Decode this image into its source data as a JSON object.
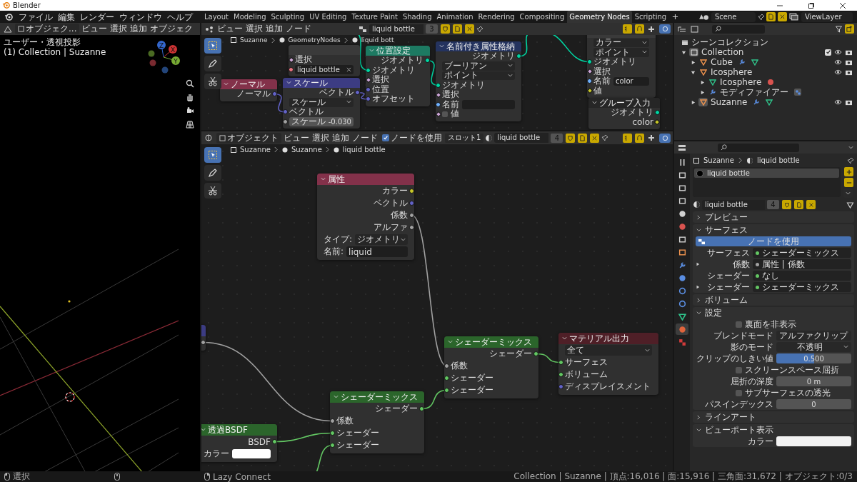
{
  "window": {
    "title": "Blender"
  },
  "menu": [
    "ファイル",
    "編集",
    "レンダー",
    "ウィンドウ",
    "ヘルプ"
  ],
  "workspaces": [
    {
      "label": "Layout",
      "selected": false
    },
    {
      "label": "Modeling",
      "selected": false
    },
    {
      "label": "Sculpting",
      "selected": false
    },
    {
      "label": "UV Editing",
      "selected": false
    },
    {
      "label": "Texture Paint",
      "selected": false
    },
    {
      "label": "Shading",
      "selected": false
    },
    {
      "label": "Animation",
      "selected": false
    },
    {
      "label": "Rendering",
      "selected": false
    },
    {
      "label": "Compositing",
      "selected": false
    },
    {
      "label": "Geometry Nodes",
      "selected": true
    },
    {
      "label": "Scripting",
      "selected": false
    }
  ],
  "scene": "Scene",
  "view_layer": "ViewLayer",
  "viewport": {
    "mode": "オブジェク...",
    "menus": [
      "ビュー",
      "選択",
      "追加",
      "オブジェク"
    ],
    "view_name": "ユーザー・透視投影",
    "collection_label": "(1) Collection | Suzanne",
    "axes": [
      "X",
      "Y",
      "Z"
    ]
  },
  "geometry_editor": {
    "menus": [
      "ビュー",
      "選択",
      "追加",
      "ノード"
    ],
    "datablock": "liquid bottle",
    "users": "3",
    "breadcrumb": [
      "Suzanne",
      "GeometryNodes",
      "liquid bott"
    ],
    "nodes": [
      {
        "kind": "plain",
        "rows": [
          {
            "kind": "input",
            "label": "選択",
            "socket": {
              "kind": "bool"
            }
          },
          {
            "kind": "field",
            "value": "liquid bottle",
            "socket": {
              "kind": "material"
            },
            "clearable": true
          }
        ]
      },
      {
        "title": "ノーマル",
        "kind": "input",
        "rows": [
          {
            "kind": "output",
            "label": "ノーマル",
            "socket": {
              "kind": "vector"
            }
          }
        ]
      },
      {
        "title": "スケール",
        "kind": "vector",
        "rows": [
          {
            "kind": "output",
            "label": "ベクトル",
            "socket": {
              "kind": "vector"
            }
          },
          {
            "kind": "dropdown",
            "value": "スケール"
          },
          {
            "kind": "input",
            "label": "ベクトル",
            "socket": {
              "kind": "vector"
            }
          },
          {
            "kind": "number",
            "label": "スケール",
            "value": "-0.030",
            "socket": {
              "kind": "float"
            }
          }
        ]
      },
      {
        "title": "位置設定",
        "kind": "geometry",
        "rows": [
          {
            "kind": "output",
            "label": "ジオメトリ",
            "socket": {
              "kind": "geometry"
            }
          },
          {
            "kind": "input",
            "label": "ジオメトリ",
            "socket": {
              "kind": "geometry"
            }
          },
          {
            "kind": "input",
            "label": "選択",
            "socket": {
              "kind": "bool"
            }
          },
          {
            "kind": "input",
            "label": "位置",
            "socket": {
              "kind": "vector"
            }
          },
          {
            "kind": "input",
            "label": "オフセット",
            "socket": {
              "kind": "vector"
            }
          }
        ]
      },
      {
        "title": "名前付き属性格納",
        "kind": "attribute",
        "rows": [
          {
            "kind": "output",
            "label": "ジオメトリ",
            "socket": {
              "kind": "geometry"
            }
          },
          {
            "kind": "dropdown",
            "value": "ブーリアン"
          },
          {
            "kind": "dropdown",
            "value": "ポイント"
          },
          {
            "kind": "input",
            "label": "ジオメトリ",
            "socket": {
              "kind": "geometry"
            }
          },
          {
            "kind": "input",
            "label": "選択",
            "socket": {
              "kind": "bool"
            }
          },
          {
            "kind": "field",
            "label": "名前",
            "socket": {
              "kind": "string"
            }
          },
          {
            "kind": "checkbox",
            "label": "値",
            "checked": false,
            "socket": {
              "kind": "bool"
            }
          }
        ]
      },
      {
        "kind": "plain",
        "rows": [
          {
            "kind": "dropdown",
            "value": "カラー"
          },
          {
            "kind": "dropdown",
            "value": "ポイント"
          },
          {
            "kind": "input",
            "label": "ジオメトリ",
            "socket": {
              "kind": "geometry"
            }
          },
          {
            "kind": "input",
            "label": "選択",
            "socket": {
              "kind": "bool"
            }
          },
          {
            "kind": "field",
            "label": "名前",
            "value": "color",
            "socket": {
              "kind": "string"
            }
          },
          {
            "kind": "input",
            "label": "値",
            "socket": {
              "kind": "color_field"
            }
          }
        ]
      },
      {
        "title": "グループ入力",
        "kind": "group",
        "rows": [
          {
            "kind": "output",
            "label": "ジオメトリ",
            "socket": {
              "kind": "geometry"
            }
          },
          {
            "kind": "output",
            "label": "color",
            "socket": {
              "kind": "color_field"
            }
          }
        ]
      }
    ]
  },
  "shader_editor": {
    "mode": "オブジェクト",
    "menus": [
      "ビュー",
      "選択",
      "追加",
      "ノード"
    ],
    "use_nodes": {
      "label": "ノードを使用",
      "checked": true
    },
    "slot": "スロット1",
    "material": "liquid bottle",
    "users": "4",
    "breadcrumb": [
      "Suzanne",
      "Suzanne",
      "liquid bottle"
    ],
    "nodes": [
      {
        "title": "属性",
        "kind": "input",
        "rows": [
          {
            "kind": "output",
            "label": "カラー",
            "socket": {
              "kind": "color"
            }
          },
          {
            "kind": "output",
            "label": "ベクトル",
            "socket": {
              "kind": "vector"
            }
          },
          {
            "kind": "output",
            "label": "係数",
            "socket": {
              "kind": "float"
            }
          },
          {
            "kind": "output",
            "label": "アルファ",
            "socket": {
              "kind": "float"
            }
          },
          {
            "kind": "dropdown",
            "label": "タイプ:",
            "value": "ジオメトリ"
          },
          {
            "kind": "field",
            "label": "名前:",
            "value": "liquid"
          }
        ]
      },
      {
        "title": "シェーダーミックス",
        "kind": "shader",
        "rows": [
          {
            "kind": "output",
            "label": "シェーダー",
            "socket": {
              "kind": "shader"
            }
          },
          {
            "kind": "input",
            "label": "係数",
            "socket": {
              "kind": "float"
            }
          },
          {
            "kind": "input",
            "label": "シェーダー",
            "socket": {
              "kind": "shader"
            }
          },
          {
            "kind": "input",
            "label": "シェーダー",
            "socket": {
              "kind": "shader"
            }
          }
        ]
      },
      {
        "title": "マテリアル出力",
        "kind": "output",
        "rows": [
          {
            "kind": "dropdown",
            "value": "全て"
          },
          {
            "kind": "input",
            "label": "サーフェス",
            "socket": {
              "kind": "shader"
            }
          },
          {
            "kind": "input",
            "label": "ボリューム",
            "socket": {
              "kind": "shader"
            }
          },
          {
            "kind": "input",
            "label": "ディスプレイスメント",
            "socket": {
              "kind": "vector"
            }
          }
        ]
      },
      {
        "title": "シェーダーミックス",
        "kind": "shader",
        "rows": [
          {
            "kind": "output",
            "label": "シェーダー",
            "socket": {
              "kind": "shader"
            }
          },
          {
            "kind": "input",
            "label": "係数",
            "socket": {
              "kind": "float"
            }
          },
          {
            "kind": "input",
            "label": "シェーダー",
            "socket": {
              "kind": "shader"
            }
          },
          {
            "kind": "input",
            "label": "シェーダー",
            "socket": {
              "kind": "shader"
            }
          }
        ]
      },
      {
        "title": "透過BSDF",
        "kind": "shader",
        "rows": [
          {
            "kind": "output",
            "label": "BSDF",
            "socket": {
              "kind": "shader"
            }
          },
          {
            "kind": "color",
            "label": "カラー",
            "color": "#ffffff"
          }
        ]
      },
      {
        "kind": "vector",
        "rows": [
          {
            "kind": "output",
            "socket": {
              "kind": "float"
            }
          }
        ]
      }
    ]
  },
  "outliner": {
    "root": "シーンコレクション",
    "items": [
      {
        "name": "Collection",
        "kind": "collection",
        "expanded": true,
        "active": true,
        "checked": true,
        "visible": true,
        "children": [
          {
            "name": "Cube",
            "kind": "object",
            "expanded": false,
            "active": false,
            "visible": true,
            "badges": [
              {
                "kind": "modifier"
              },
              {
                "kind": "mesh"
              }
            ]
          },
          {
            "name": "Icosphere",
            "kind": "object",
            "expanded": true,
            "active": false,
            "visible": true,
            "children": [
              {
                "name": "Icosphere",
                "kind": "mesh",
                "expanded": false,
                "active": false,
                "badges": [
                  {
                    "kind": "material"
                  }
                ]
              },
              {
                "name": "モディファイアー",
                "kind": "modifier",
                "expanded": false,
                "active": false,
                "badges": [
                  {
                    "kind": "geometry_nodes"
                  }
                ]
              }
            ]
          },
          {
            "name": "Suzanne",
            "kind": "object",
            "expanded": false,
            "active": true,
            "visible": true,
            "badges": [
              {
                "kind": "modifier"
              },
              {
                "kind": "mesh"
              }
            ]
          }
        ]
      }
    ]
  },
  "properties": {
    "tabs": [
      {
        "kind": "tool",
        "selected": false
      },
      {
        "kind": "render",
        "selected": false
      },
      {
        "kind": "output",
        "selected": false
      },
      {
        "kind": "view_layer",
        "selected": false
      },
      {
        "kind": "scene",
        "selected": false
      },
      {
        "kind": "world",
        "selected": false
      },
      {
        "kind": "collection",
        "selected": false
      },
      {
        "kind": "object",
        "selected": false
      },
      {
        "kind": "modifier",
        "selected": false
      },
      {
        "kind": "particles",
        "selected": false
      },
      {
        "kind": "physics",
        "selected": false
      },
      {
        "kind": "constraint",
        "selected": false
      },
      {
        "kind": "data",
        "selected": false
      },
      {
        "kind": "material",
        "selected": true
      },
      {
        "kind": "texture",
        "selected": false
      }
    ],
    "breadcrumb": [
      "Suzanne",
      "liquid bottle"
    ],
    "slots": [
      {
        "name": "liquid bottle",
        "selected": true
      }
    ],
    "material": "liquid bottle",
    "users": "4",
    "sections": [
      {
        "title": "プレビュー",
        "expanded": false
      },
      {
        "title": "サーフェス",
        "expanded": true,
        "rows": [
          {
            "kind": "button",
            "label": "ノードを使用"
          },
          {
            "kind": "socket",
            "label": "サーフェス",
            "value": "シェーダーミックス",
            "socket": {
              "kind": "shader"
            },
            "expandable": false
          },
          {
            "kind": "socket",
            "label": "係数",
            "value": "属性 | 係数",
            "socket": {
              "kind": "float"
            },
            "expandable": true
          },
          {
            "kind": "socket",
            "label": "シェーダー",
            "value": "なし",
            "socket": {
              "kind": "shader"
            },
            "expandable": false
          },
          {
            "kind": "socket",
            "label": "シェーダー",
            "value": "シェーダーミックス",
            "socket": {
              "kind": "shader"
            },
            "expandable": true
          }
        ]
      },
      {
        "title": "ボリューム",
        "expanded": false
      },
      {
        "title": "設定",
        "expanded": true,
        "rows": [
          {
            "kind": "checkbox",
            "label": "裏面を非表示",
            "checked": false
          },
          {
            "kind": "select",
            "label": "ブレンドモード",
            "value": "アルファクリップ"
          },
          {
            "kind": "select",
            "label": "影のモード",
            "value": "不透明"
          },
          {
            "kind": "slider",
            "label": "クリップのしきい値",
            "value": "0.500",
            "level": 0.5
          },
          {
            "kind": "checkbox",
            "label": "スクリーンスペース屈折",
            "checked": false
          },
          {
            "kind": "number",
            "label": "屈折の深度",
            "value": "0 m"
          },
          {
            "kind": "checkbox",
            "label": "サブサーフェスの透光",
            "checked": false
          },
          {
            "kind": "number",
            "label": "パスインデックス",
            "value": "0"
          }
        ]
      },
      {
        "title": "ラインアート",
        "expanded": false
      },
      {
        "title": "ビューポート表示",
        "expanded": true,
        "rows": [
          {
            "kind": "color",
            "label": "カラー",
            "color": "#f2f2f2"
          }
        ]
      }
    ]
  },
  "status_bar": {
    "hints": [
      {
        "kind": "left",
        "label": "選択"
      },
      {
        "kind": "middle"
      },
      {
        "kind": "right",
        "label": "Lazy Connect"
      }
    ],
    "stats": "Collection | Suzanne | 頂点:16,016 | 面:15,916 | 三角面:31,672 | オブジェクト:0/3"
  }
}
